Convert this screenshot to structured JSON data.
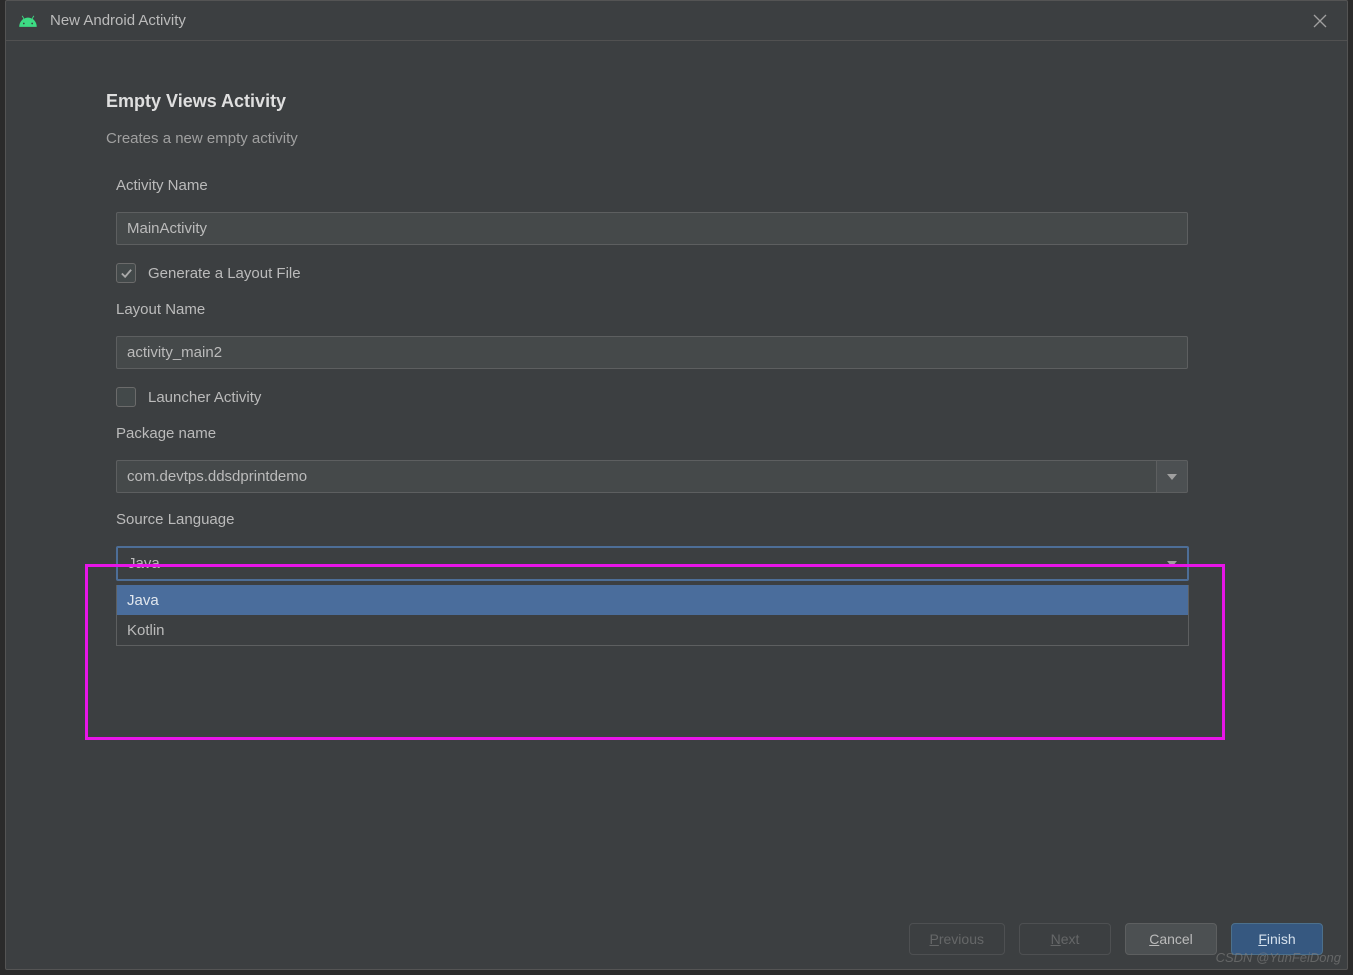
{
  "dialog": {
    "title": "New Android Activity"
  },
  "header": {
    "title": "Empty Views Activity",
    "subtitle": "Creates a new empty activity"
  },
  "fields": {
    "activityName": {
      "label": "Activity Name",
      "value": "MainActivity"
    },
    "generateLayout": {
      "label": "Generate a Layout File",
      "checked": true
    },
    "layoutName": {
      "label": "Layout Name",
      "value": "activity_main2"
    },
    "launcherActivity": {
      "label": "Launcher Activity",
      "checked": false
    },
    "packageName": {
      "label": "Package name",
      "value": "com.devtps.ddsdprintdemo"
    },
    "sourceLanguage": {
      "label": "Source Language",
      "value": "Java",
      "options": [
        "Java",
        "Kotlin"
      ]
    }
  },
  "buttons": {
    "previous": "Previous",
    "next": "Next",
    "cancel": "Cancel",
    "finish": "Finish"
  },
  "watermark": "CSDN @YunFeiDong"
}
